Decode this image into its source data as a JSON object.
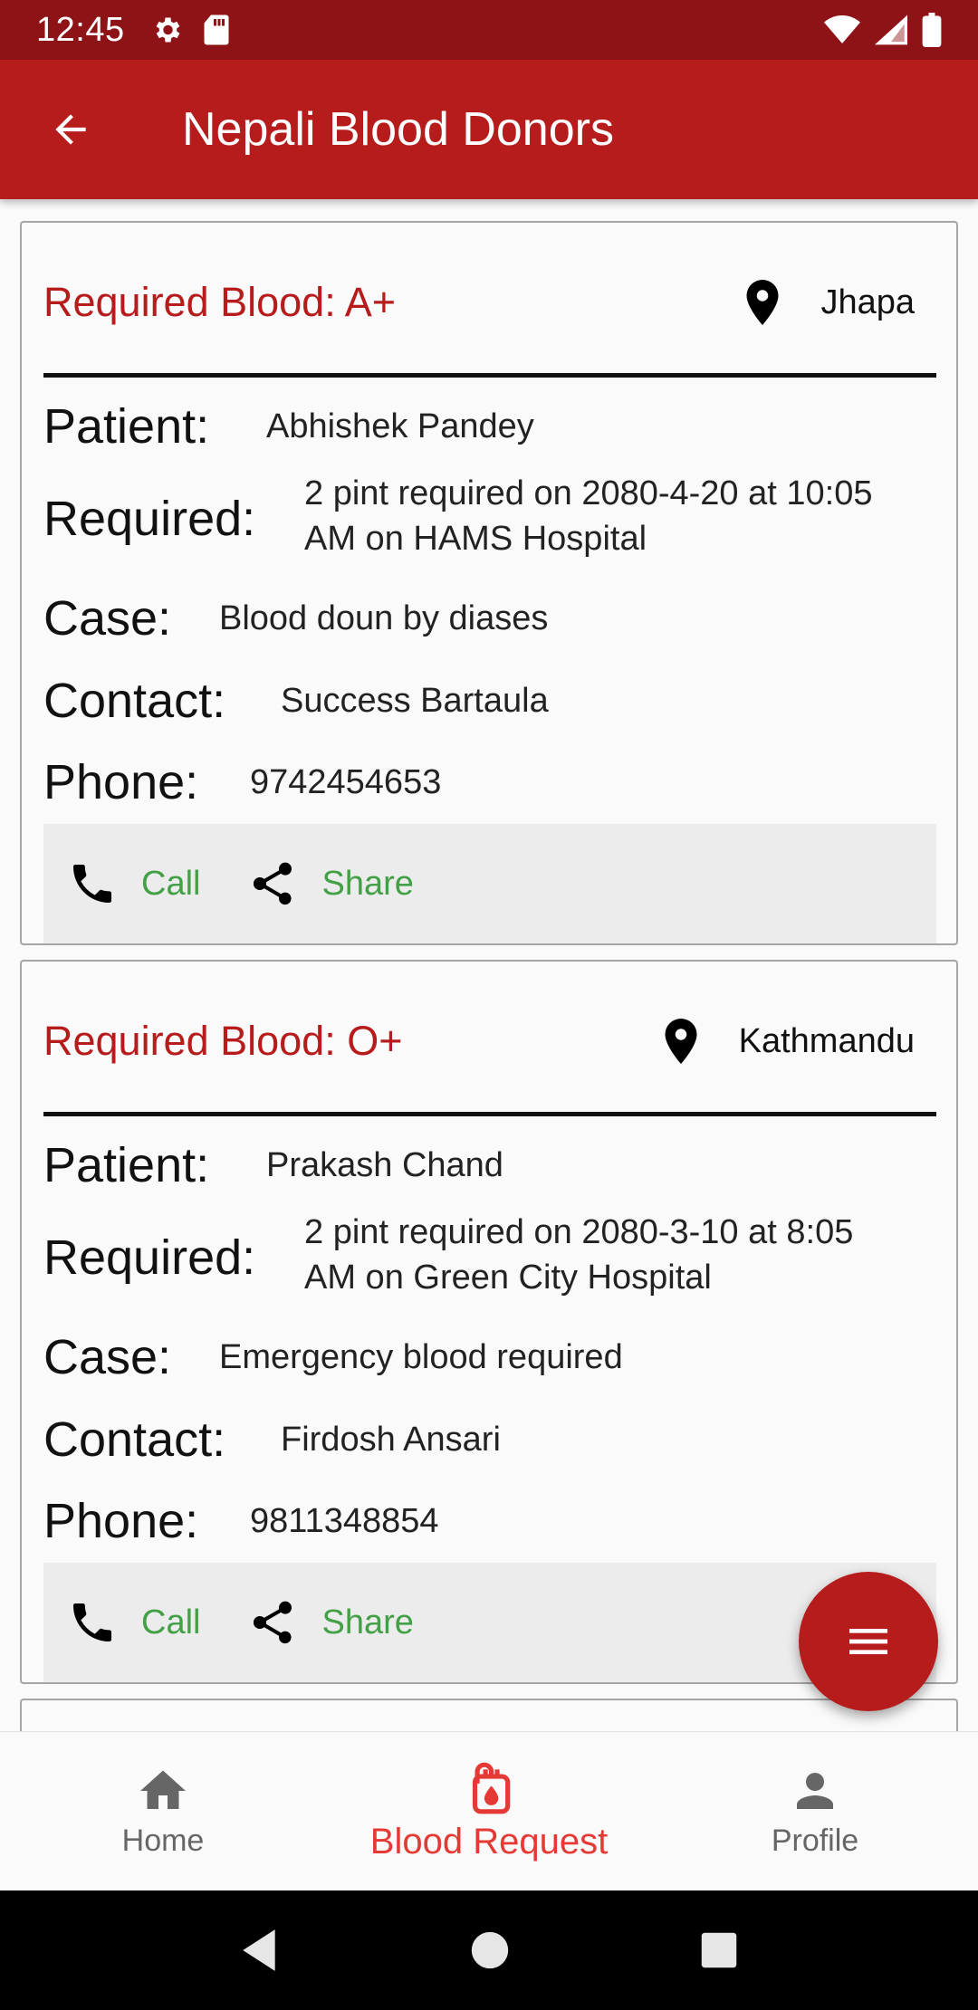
{
  "status_bar": {
    "time": "12:45"
  },
  "app_bar": {
    "title": "Nepali Blood Donors"
  },
  "labels": {
    "patient": "Patient:",
    "required": "Required:",
    "case": "Case:",
    "contact": "Contact:",
    "phone": "Phone:"
  },
  "requests": [
    {
      "blood_label": "Required Blood: A+",
      "location": "Jhapa",
      "patient": "Abhishek Pandey",
      "required_line1": "2 pint required on 2080-4-20 at 10:05",
      "required_line2": "AM on HAMS Hospital",
      "case": "Blood doun by diases",
      "contact": "Success Bartaula",
      "phone": "9742454653",
      "call_label": "Call",
      "share_label": "Share"
    },
    {
      "blood_label": "Required Blood: O+",
      "location": "Kathmandu",
      "patient": "Prakash Chand",
      "required_line1": "2 pint required on 2080-3-10 at 8:05",
      "required_line2": "AM on Green City Hospital",
      "case": "Emergency blood required",
      "contact": "Firdosh Ansari",
      "phone": "9811348854",
      "call_label": "Call",
      "share_label": "Share"
    }
  ],
  "bottom_nav": {
    "items": [
      {
        "label": "Home",
        "icon": "home-icon",
        "active": false
      },
      {
        "label": "Blood Request",
        "icon": "blood-bag-icon",
        "active": true
      },
      {
        "label": "Profile",
        "icon": "person-icon",
        "active": false
      }
    ]
  },
  "colors": {
    "primary": "#b71c1c",
    "status_bar": "#8e1316",
    "action_green": "#43a047",
    "nav_active": "#e53935"
  }
}
